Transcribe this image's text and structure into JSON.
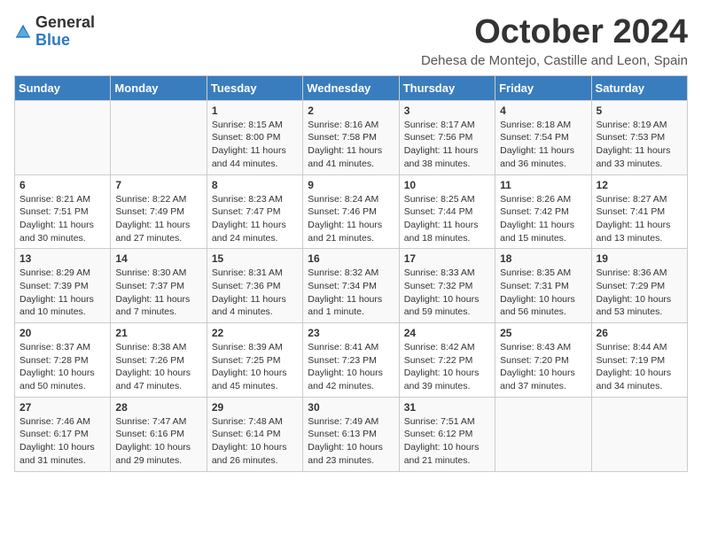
{
  "header": {
    "logo_general": "General",
    "logo_blue": "Blue",
    "month_title": "October 2024",
    "location": "Dehesa de Montejo, Castille and Leon, Spain"
  },
  "days_of_week": [
    "Sunday",
    "Monday",
    "Tuesday",
    "Wednesday",
    "Thursday",
    "Friday",
    "Saturday"
  ],
  "weeks": [
    [
      {
        "day": "",
        "info": ""
      },
      {
        "day": "",
        "info": ""
      },
      {
        "day": "1",
        "info": "Sunrise: 8:15 AM\nSunset: 8:00 PM\nDaylight: 11 hours and 44 minutes."
      },
      {
        "day": "2",
        "info": "Sunrise: 8:16 AM\nSunset: 7:58 PM\nDaylight: 11 hours and 41 minutes."
      },
      {
        "day": "3",
        "info": "Sunrise: 8:17 AM\nSunset: 7:56 PM\nDaylight: 11 hours and 38 minutes."
      },
      {
        "day": "4",
        "info": "Sunrise: 8:18 AM\nSunset: 7:54 PM\nDaylight: 11 hours and 36 minutes."
      },
      {
        "day": "5",
        "info": "Sunrise: 8:19 AM\nSunset: 7:53 PM\nDaylight: 11 hours and 33 minutes."
      }
    ],
    [
      {
        "day": "6",
        "info": "Sunrise: 8:21 AM\nSunset: 7:51 PM\nDaylight: 11 hours and 30 minutes."
      },
      {
        "day": "7",
        "info": "Sunrise: 8:22 AM\nSunset: 7:49 PM\nDaylight: 11 hours and 27 minutes."
      },
      {
        "day": "8",
        "info": "Sunrise: 8:23 AM\nSunset: 7:47 PM\nDaylight: 11 hours and 24 minutes."
      },
      {
        "day": "9",
        "info": "Sunrise: 8:24 AM\nSunset: 7:46 PM\nDaylight: 11 hours and 21 minutes."
      },
      {
        "day": "10",
        "info": "Sunrise: 8:25 AM\nSunset: 7:44 PM\nDaylight: 11 hours and 18 minutes."
      },
      {
        "day": "11",
        "info": "Sunrise: 8:26 AM\nSunset: 7:42 PM\nDaylight: 11 hours and 15 minutes."
      },
      {
        "day": "12",
        "info": "Sunrise: 8:27 AM\nSunset: 7:41 PM\nDaylight: 11 hours and 13 minutes."
      }
    ],
    [
      {
        "day": "13",
        "info": "Sunrise: 8:29 AM\nSunset: 7:39 PM\nDaylight: 11 hours and 10 minutes."
      },
      {
        "day": "14",
        "info": "Sunrise: 8:30 AM\nSunset: 7:37 PM\nDaylight: 11 hours and 7 minutes."
      },
      {
        "day": "15",
        "info": "Sunrise: 8:31 AM\nSunset: 7:36 PM\nDaylight: 11 hours and 4 minutes."
      },
      {
        "day": "16",
        "info": "Sunrise: 8:32 AM\nSunset: 7:34 PM\nDaylight: 11 hours and 1 minute."
      },
      {
        "day": "17",
        "info": "Sunrise: 8:33 AM\nSunset: 7:32 PM\nDaylight: 10 hours and 59 minutes."
      },
      {
        "day": "18",
        "info": "Sunrise: 8:35 AM\nSunset: 7:31 PM\nDaylight: 10 hours and 56 minutes."
      },
      {
        "day": "19",
        "info": "Sunrise: 8:36 AM\nSunset: 7:29 PM\nDaylight: 10 hours and 53 minutes."
      }
    ],
    [
      {
        "day": "20",
        "info": "Sunrise: 8:37 AM\nSunset: 7:28 PM\nDaylight: 10 hours and 50 minutes."
      },
      {
        "day": "21",
        "info": "Sunrise: 8:38 AM\nSunset: 7:26 PM\nDaylight: 10 hours and 47 minutes."
      },
      {
        "day": "22",
        "info": "Sunrise: 8:39 AM\nSunset: 7:25 PM\nDaylight: 10 hours and 45 minutes."
      },
      {
        "day": "23",
        "info": "Sunrise: 8:41 AM\nSunset: 7:23 PM\nDaylight: 10 hours and 42 minutes."
      },
      {
        "day": "24",
        "info": "Sunrise: 8:42 AM\nSunset: 7:22 PM\nDaylight: 10 hours and 39 minutes."
      },
      {
        "day": "25",
        "info": "Sunrise: 8:43 AM\nSunset: 7:20 PM\nDaylight: 10 hours and 37 minutes."
      },
      {
        "day": "26",
        "info": "Sunrise: 8:44 AM\nSunset: 7:19 PM\nDaylight: 10 hours and 34 minutes."
      }
    ],
    [
      {
        "day": "27",
        "info": "Sunrise: 7:46 AM\nSunset: 6:17 PM\nDaylight: 10 hours and 31 minutes."
      },
      {
        "day": "28",
        "info": "Sunrise: 7:47 AM\nSunset: 6:16 PM\nDaylight: 10 hours and 29 minutes."
      },
      {
        "day": "29",
        "info": "Sunrise: 7:48 AM\nSunset: 6:14 PM\nDaylight: 10 hours and 26 minutes."
      },
      {
        "day": "30",
        "info": "Sunrise: 7:49 AM\nSunset: 6:13 PM\nDaylight: 10 hours and 23 minutes."
      },
      {
        "day": "31",
        "info": "Sunrise: 7:51 AM\nSunset: 6:12 PM\nDaylight: 10 hours and 21 minutes."
      },
      {
        "day": "",
        "info": ""
      },
      {
        "day": "",
        "info": ""
      }
    ]
  ]
}
